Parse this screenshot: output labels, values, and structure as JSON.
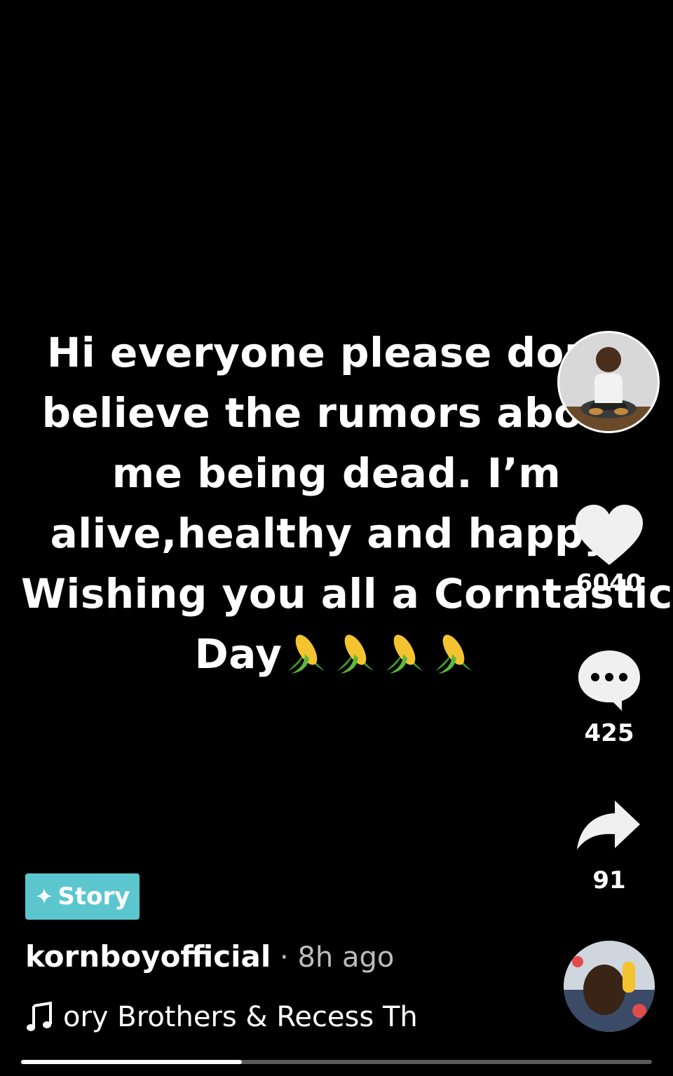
{
  "post": {
    "caption_lines": [
      "Hi everyone please don't",
      "believe the rumors about",
      "me being dead. I’m",
      "alive,healthy and happy.",
      "Wishing you all a Corntastic",
      "Day"
    ],
    "caption_emoji": [
      "corn-emoji",
      "corn-emoji",
      "corn-emoji",
      "corn-emoji"
    ]
  },
  "actions": {
    "likes": "6040",
    "comments": "425",
    "shares": "91"
  },
  "story_badge": {
    "icon": "sparkle-icon",
    "label": "Story",
    "color": "#5cc6cf"
  },
  "author": {
    "name": "kornboyofficial",
    "time": " · 8h ago"
  },
  "music": {
    "text": "ory Brothers & Recess Th"
  },
  "playback": {
    "progress_fraction": 0.35
  }
}
